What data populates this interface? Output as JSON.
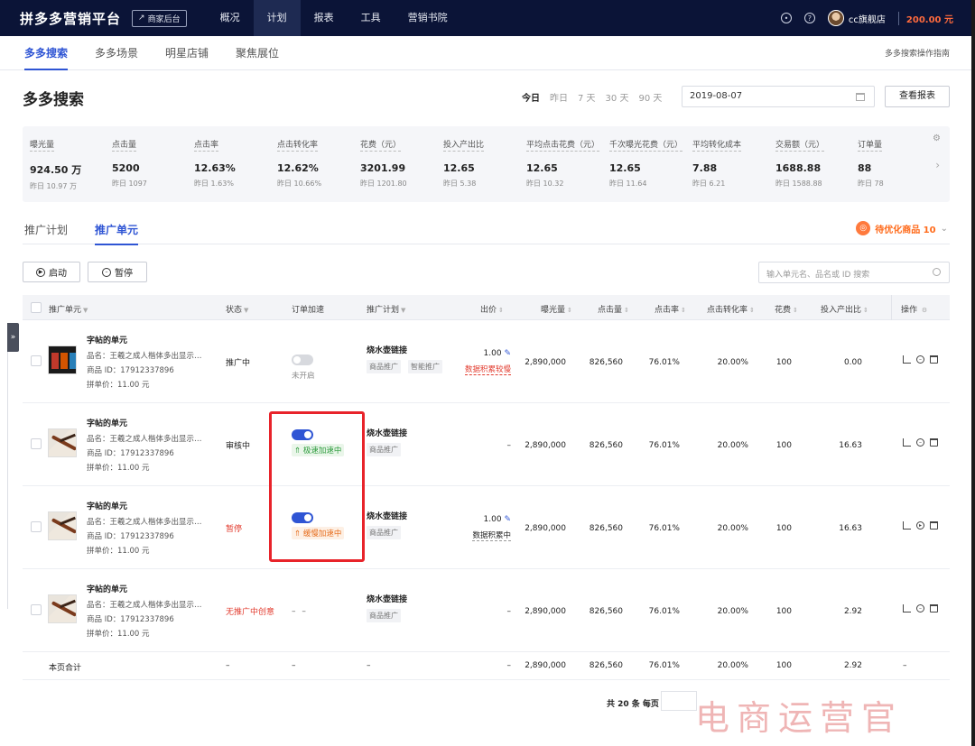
{
  "topbar": {
    "brand": "拼多多营销平台",
    "merchant_link": "商家后台",
    "nav": [
      "概况",
      "计划",
      "报表",
      "工具",
      "营销书院"
    ],
    "active_nav": "计划",
    "user_name": "cc旗舰店",
    "balance": "200.00 元"
  },
  "subtabs": {
    "items": [
      "多多搜索",
      "多多场景",
      "明星店铺",
      "聚焦展位"
    ],
    "active": "多多搜索",
    "guide": "多多搜索操作指南"
  },
  "header": {
    "title": "多多搜索",
    "ranges": [
      "今日",
      "昨日",
      "7 天",
      "30 天",
      "90 天"
    ],
    "active_range": "今日",
    "date": "2019-08-07",
    "report_button": "查看报表"
  },
  "metrics": [
    {
      "label": "曝光量",
      "value": "924.50 万",
      "prev": "昨日 10.97 万"
    },
    {
      "label": "点击量",
      "value": "5200",
      "prev": "昨日 1097"
    },
    {
      "label": "点击率",
      "value": "12.63%",
      "prev": "昨日 1.63%"
    },
    {
      "label": "点击转化率",
      "value": "12.62%",
      "prev": "昨日 10.66%"
    },
    {
      "label": "花费（元）",
      "value": "3201.99",
      "prev": "昨日 1201.80"
    },
    {
      "label": "投入产出比",
      "value": "12.65",
      "prev": "昨日 5.38"
    },
    {
      "label": "平均点击花费（元）",
      "value": "12.65",
      "prev": "昨日 10.32"
    },
    {
      "label": "千次曝光花费（元）",
      "value": "12.65",
      "prev": "昨日 11.64"
    },
    {
      "label": "平均转化成本",
      "value": "7.88",
      "prev": "昨日 6.21"
    },
    {
      "label": "交易额（元）",
      "value": "1688.88",
      "prev": "昨日 1588.88"
    },
    {
      "label": "订单量",
      "value": "88",
      "prev": "昨日 78"
    }
  ],
  "tabs": {
    "items": [
      "推广计划",
      "推广单元"
    ],
    "active": "推广单元",
    "optimize_label": "待优化商品 10"
  },
  "actions": {
    "start": "启动",
    "pause": "暂停",
    "search_placeholder": "输入单元名、品名或 ID 搜索"
  },
  "table": {
    "headers": {
      "unit": "推广单元",
      "status": "状态",
      "accel": "订单加速",
      "plan": "推广计划",
      "bid": "出价",
      "impressions": "曝光量",
      "clicks": "点击量",
      "ctr": "点击率",
      "cvr": "点击转化率",
      "cost": "花费",
      "roi": "投入产出比",
      "ops": "操作"
    },
    "rows": [
      {
        "name": "字帖的单元",
        "product": "品名：王羲之成人楷体多出显示…",
        "pid": "商品 ID：17912337896",
        "price": "拼单价：11.00 元",
        "status": "推广中",
        "accel_label": "未开启",
        "plan": "烧水壶链接",
        "tags": [
          "商品推广",
          "智能推广"
        ],
        "bid": "1.00",
        "bid_note": "数据积累较慢",
        "impressions": "2,890,000",
        "clicks": "826,560",
        "ctr": "76.01%",
        "cvr": "20.00%",
        "cost": "100",
        "roi": "0.00"
      },
      {
        "name": "字帖的单元",
        "product": "品名：王羲之成人楷体多出显示…",
        "pid": "商品 ID：17912337896",
        "price": "拼单价：11.00 元",
        "status": "审核中",
        "accel_label": "极速加速中",
        "plan": "烧水壶链接",
        "tags": [
          "商品推广"
        ],
        "bid": "–",
        "impressions": "2,890,000",
        "clicks": "826,560",
        "ctr": "76.01%",
        "cvr": "20.00%",
        "cost": "100",
        "roi": "16.63"
      },
      {
        "name": "字帖的单元",
        "product": "品名：王羲之成人楷体多出显示…",
        "pid": "商品 ID：17912337896",
        "price": "拼单价：11.00 元",
        "status": "暂停",
        "accel_label": "缓慢加速中",
        "plan": "烧水壶链接",
        "tags": [
          "商品推广"
        ],
        "bid": "1.00",
        "bid_note": "数据积累中",
        "impressions": "2,890,000",
        "clicks": "826,560",
        "ctr": "76.01%",
        "cvr": "20.00%",
        "cost": "100",
        "roi": "16.63"
      },
      {
        "name": "字帖的单元",
        "product": "品名：王羲之成人楷体多出显示…",
        "pid": "商品 ID：17912337896",
        "price": "拼单价：11.00 元",
        "status": "无推广中创意",
        "accel_label": "– –",
        "plan": "烧水壶链接",
        "tags": [
          "商品推广"
        ],
        "bid": "–",
        "impressions": "2,890,000",
        "clicks": "826,560",
        "ctr": "76.01%",
        "cvr": "20.00%",
        "cost": "100",
        "roi": "2.92"
      }
    ],
    "summary": {
      "label": "本页合计",
      "status": "–",
      "accel": "–",
      "plan": "–",
      "bid": "–",
      "impressions": "2,890,000",
      "clicks": "826,560",
      "ctr": "76.01%",
      "cvr": "20.00%",
      "cost": "100",
      "roi": "2.92",
      "ops": "–"
    }
  },
  "pager": {
    "text": "共 20 条 每页"
  },
  "watermark": "电商运营官",
  "colors": {
    "brand": "#2f55d4",
    "topbar": "#0b1437",
    "highlight": "#e8232a",
    "warn": "#ff6a1a"
  }
}
